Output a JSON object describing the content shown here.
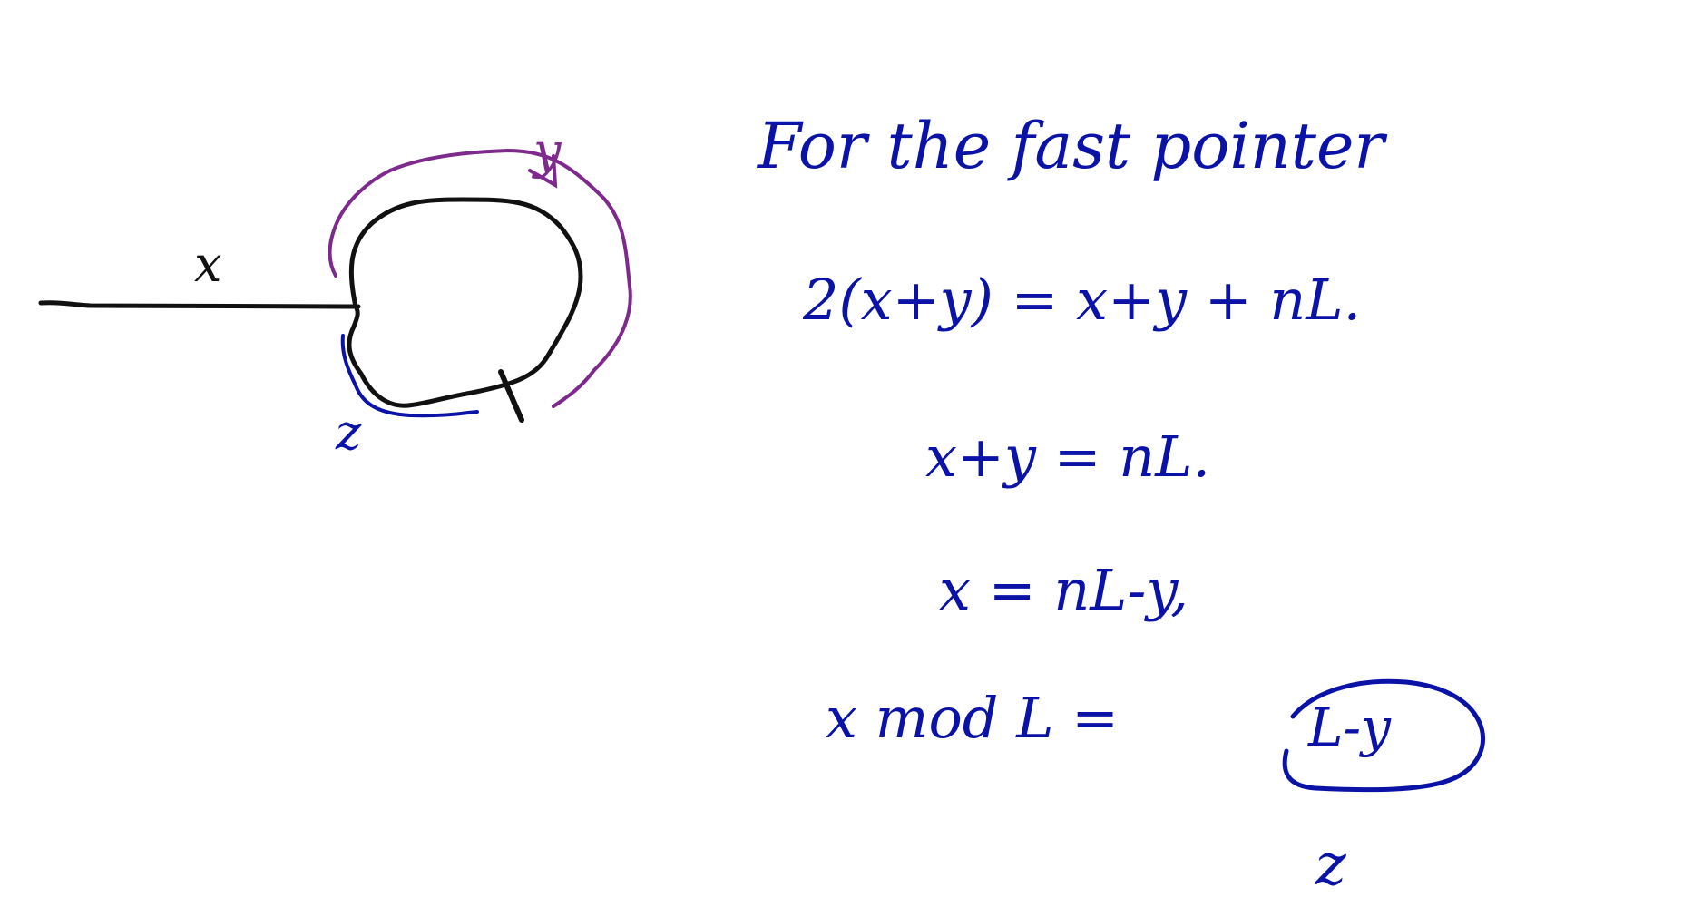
{
  "diagram": {
    "labels": {
      "x": "x",
      "y": "y",
      "z": "z"
    }
  },
  "notes": {
    "title": "For the fast pointer",
    "eq1": "2(x+y) = x+y + nL.",
    "eq2": "x+y = nL.",
    "eq3": "x = nL-y,",
    "eq4_left": "x mod L =",
    "eq4_right": "L-y",
    "eq4_under": "z"
  },
  "colors": {
    "blue_ink": "#0b12a6",
    "black_ink": "#111111",
    "purple_ink": "#7d2a8c"
  }
}
